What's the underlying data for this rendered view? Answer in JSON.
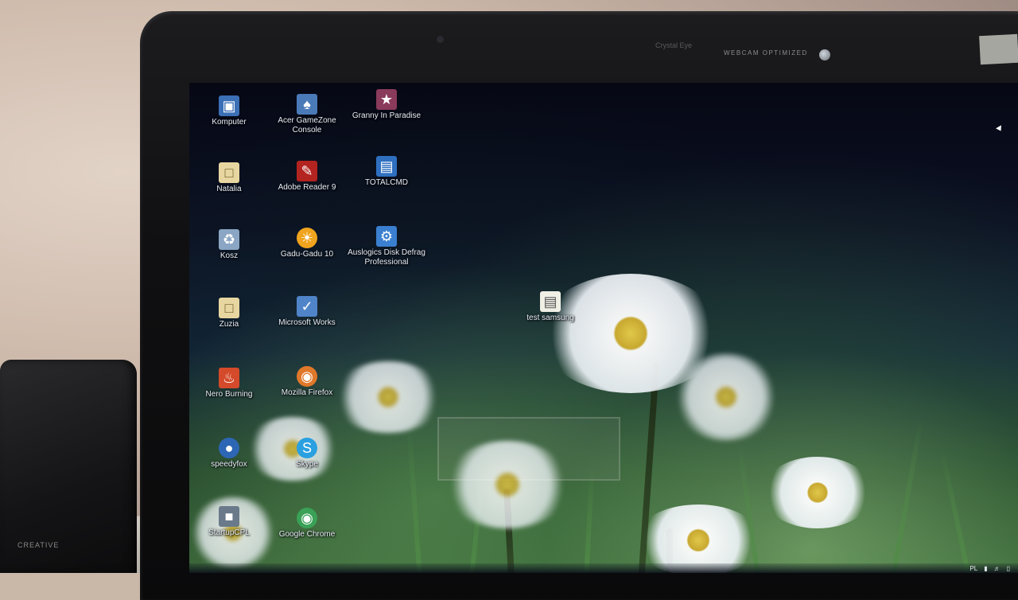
{
  "bezel": {
    "camera_label": "Crystal Eye",
    "webcam_label": "WEBCAM OPTIMIZED",
    "speaker_brand": "CREATIVE"
  },
  "desktop": {
    "icons": [
      {
        "label": "Komputer",
        "icon": "computer-icon",
        "color": "#3b6fb6"
      },
      {
        "label": "Acer GameZone Console",
        "icon": "gamezone-icon",
        "color": "#4a7ab8"
      },
      {
        "label": "Granny In Paradise",
        "icon": "game-icon",
        "color": "#8a3a5a"
      },
      {
        "label": "Natalia",
        "icon": "user-folder-icon",
        "color": "#e8d6a0"
      },
      {
        "label": "Adobe Reader 9",
        "icon": "pdf-icon",
        "color": "#b3231f"
      },
      {
        "label": "TOTALCMD",
        "icon": "floppy-disk-icon",
        "color": "#2f6fc0"
      },
      {
        "label": "Kosz",
        "icon": "recycle-bin-icon",
        "color": "#8aa6c4"
      },
      {
        "label": "Gadu-Gadu 10",
        "icon": "sunflower-icon",
        "color": "#f0a41e"
      },
      {
        "label": "Auslogics Disk Defrag Professional",
        "icon": "defrag-icon",
        "color": "#3a7fd0"
      },
      {
        "label": "Zuzia",
        "icon": "user-folder-icon",
        "color": "#e8d6a0"
      },
      {
        "label": "Microsoft Works",
        "icon": "works-icon",
        "color": "#4f84c9"
      },
      {
        "label": "Nero Burning",
        "icon": "flame-icon",
        "color": "#d44a2a"
      },
      {
        "label": "Mozilla Firefox",
        "icon": "firefox-icon",
        "color": "#e0782a"
      },
      {
        "label": "speedyfox",
        "icon": "speedyfox-icon",
        "color": "#2d66b4"
      },
      {
        "label": "Skype",
        "icon": "skype-icon",
        "color": "#2aa0e0"
      },
      {
        "label": "StartupCPL",
        "icon": "startup-icon",
        "color": "#6a7a8a"
      },
      {
        "label": "Google Chrome",
        "icon": "chrome-icon",
        "color": "#3aa157"
      },
      {
        "label": "test samsung",
        "icon": "document-icon",
        "color": "#f0efe6"
      }
    ]
  },
  "taskbar": {
    "language": "PL"
  }
}
